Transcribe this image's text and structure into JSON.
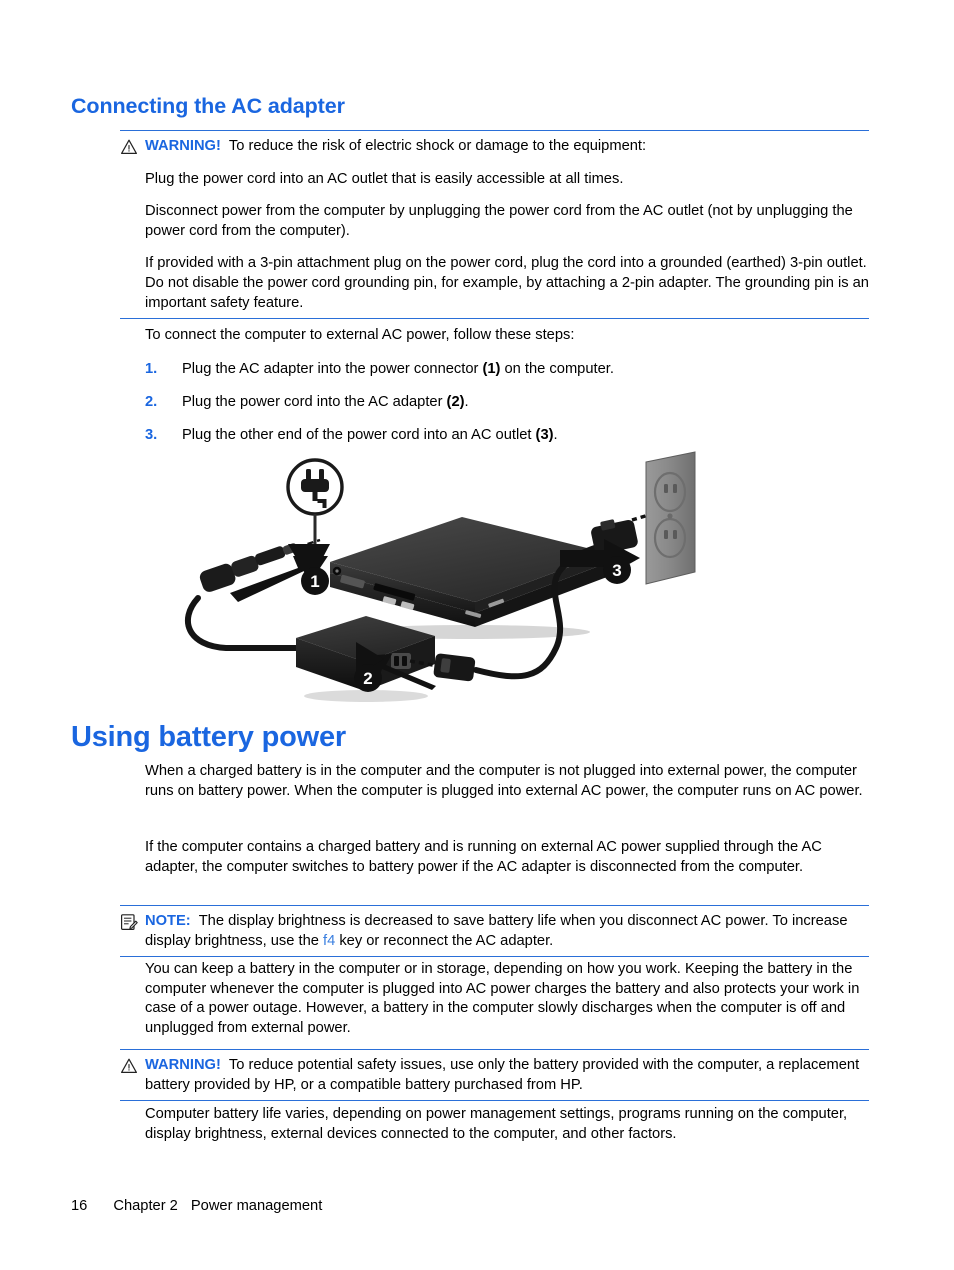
{
  "document": {
    "heading_ac": "Connecting the AC adapter",
    "heading_battery": "Using battery power"
  },
  "warning1": {
    "icon": "warning-triangle-icon",
    "label": "WARNING!",
    "lead": "To reduce the risk of electric shock or damage to the equipment:",
    "p1": "Plug the power cord into an AC outlet that is easily accessible at all times.",
    "p2": "Disconnect power from the computer by unplugging the power cord from the AC outlet (not by unplugging the power cord from the computer).",
    "p3": "If provided with a 3-pin attachment plug on the power cord, plug the cord into a grounded (earthed) 3-pin outlet. Do not disable the power cord grounding pin, for example, by attaching a 2-pin adapter. The grounding pin is an important safety feature."
  },
  "intro": {
    "steps_lead": "To connect the computer to external AC power, follow these steps:"
  },
  "steps": [
    {
      "num": "1.",
      "text_before": "Plug the AC adapter into the power connector ",
      "callout": "(1)",
      "text_after": " on the computer."
    },
    {
      "num": "2.",
      "text_before": "Plug the power cord into the AC adapter ",
      "callout": "(2)",
      "text_after": "."
    },
    {
      "num": "3.",
      "text_before": "Plug the other end of the power cord into an AC outlet ",
      "callout": "(3)",
      "text_after": "."
    }
  ],
  "figure": {
    "name": "ac-adapter-connection-diagram",
    "callout_1": "1",
    "callout_2": "2",
    "callout_3": "3",
    "connector_icon": "power-connector-icon",
    "laptop": "laptop-computer",
    "adapter": "ac-adapter-brick",
    "outlet": "wall-outlet",
    "colors": {
      "laptop_body": "#3a3a3a",
      "laptop_dark": "#1c1c1c",
      "outlet_plate": "#8a8a8a",
      "cable": "#141414",
      "badge": "#111111"
    }
  },
  "battery": {
    "p1": "When a charged battery is in the computer and the computer is not plugged into external power, the computer runs on battery power. When the computer is plugged into external AC power, the computer runs on AC power.",
    "p2": "If the computer contains a charged battery and is running on external AC power supplied through the AC adapter, the computer switches to battery power if the AC adapter is disconnected from the computer.",
    "p3": "You can keep a battery in the computer or in storage, depending on how you work. Keeping the battery in the computer whenever the computer is plugged into AC power charges the battery and also protects your work in case of a power outage. However, a battery in the computer slowly discharges when the computer is off and unplugged from external power.",
    "p4": "Computer battery life varies, depending on power management settings, programs running on the computer, display brightness, external devices connected to the computer, and other factors."
  },
  "note": {
    "icon": "note-clipboard-icon",
    "label": "NOTE:",
    "text_before": "The display brightness is decreased to save battery life when you disconnect AC power. To increase display brightness, use the ",
    "key": "f4",
    "text_after": " key or reconnect the AC adapter."
  },
  "warning2": {
    "icon": "warning-triangle-icon",
    "label": "WARNING!",
    "text": "To reduce potential safety issues, use only the battery provided with the computer, a replacement battery provided by HP, or a compatible battery purchased from HP."
  },
  "footer": {
    "page_number": "16",
    "chapter": "Chapter 2",
    "chapter_title": "Power management"
  },
  "colors": {
    "heading_blue": "#1a66e0",
    "rule_blue": "#2a6fd8",
    "body_black": "#000000"
  }
}
